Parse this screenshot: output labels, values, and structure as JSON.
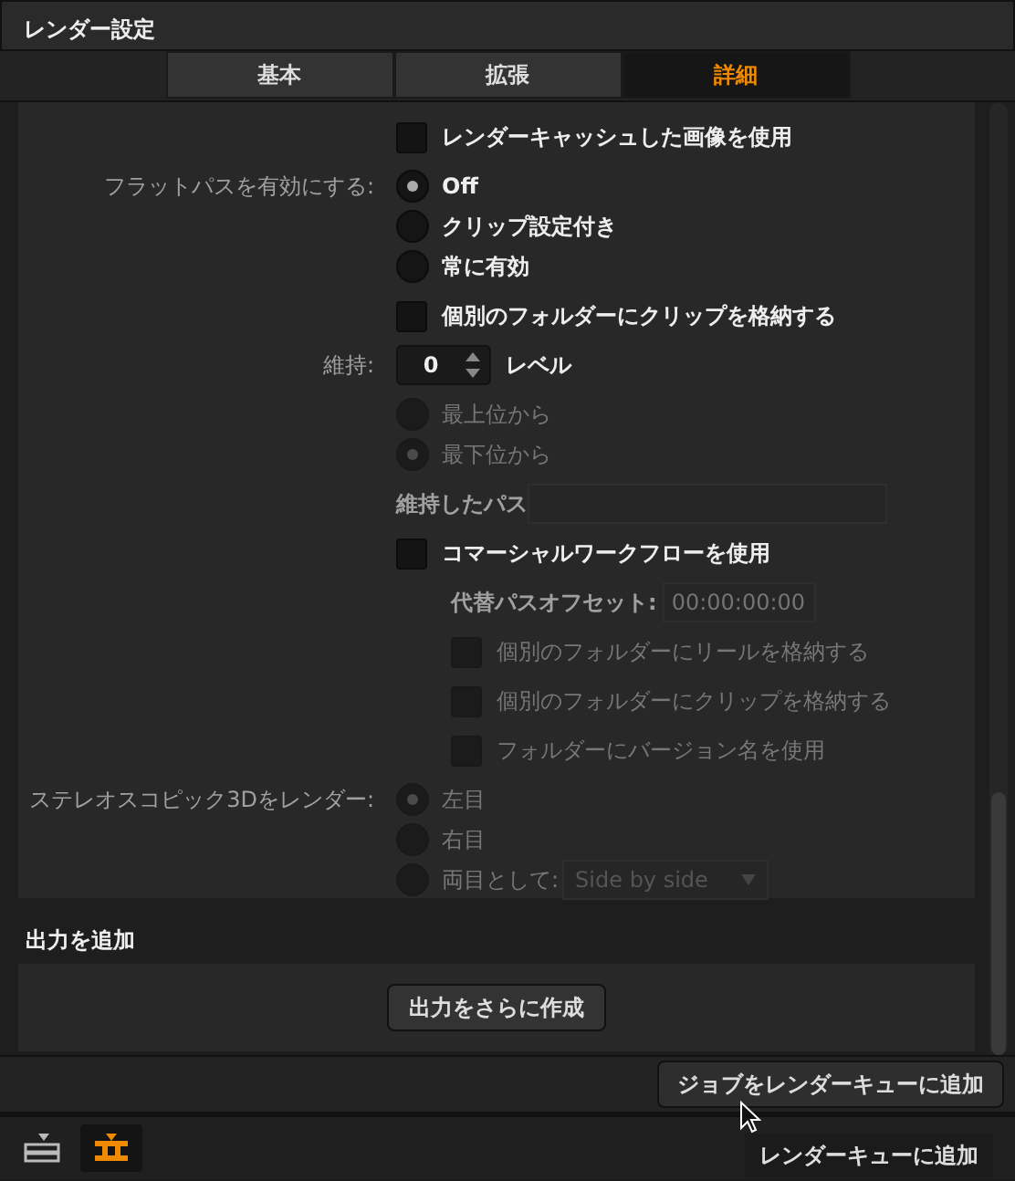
{
  "window": {
    "title": "レンダー設定"
  },
  "tabs": [
    {
      "label": "基本",
      "selected": false
    },
    {
      "label": "拡張",
      "selected": false
    },
    {
      "label": "詳細",
      "selected": true
    }
  ],
  "settings": [
    {
      "kind": "checkbox",
      "text": "レンダーキャッシュした画像を使用",
      "checked": false,
      "disabled": false
    },
    {
      "kind": "radio",
      "label": "フラットパスを有効にする:",
      "disabled": false,
      "options": [
        {
          "text": "Off",
          "selected": true
        },
        {
          "text": "クリップ設定付き",
          "selected": false
        },
        {
          "text": "常に有効",
          "selected": false
        }
      ]
    },
    {
      "kind": "checkbox",
      "text": "個別のフォルダーにクリップを格納する",
      "checked": false,
      "disabled": false
    },
    {
      "kind": "spinner",
      "label": "維持:",
      "value": "0",
      "unit": "レベル",
      "disabled": false
    },
    {
      "kind": "radio",
      "disabled": true,
      "options": [
        {
          "text": "最上位から",
          "selected": false
        },
        {
          "text": "最下位から",
          "selected": true
        }
      ]
    },
    {
      "kind": "field",
      "text": "維持したパス",
      "disabled": true
    },
    {
      "kind": "checkbox",
      "text": "コマーシャルワークフローを使用",
      "checked": false,
      "disabled": false,
      "children": [
        {
          "kind": "field",
          "text": "代替パスオフセット:",
          "placeholder": "00:00:00:00",
          "disabled": true
        },
        {
          "kind": "checkbox",
          "text": "個別のフォルダーにリールを格納する",
          "checked": false,
          "disabled": true
        },
        {
          "kind": "checkbox",
          "text": "個別のフォルダーにクリップを格納する",
          "checked": false,
          "disabled": true
        },
        {
          "kind": "checkbox",
          "text": "フォルダーにバージョン名を使用",
          "checked": false,
          "disabled": true
        }
      ]
    },
    {
      "kind": "radio",
      "label": "ステレオスコピック3Dをレンダー:",
      "disabled": true,
      "options": [
        {
          "text": "左目",
          "selected": true
        },
        {
          "text": "右目",
          "selected": false
        },
        {
          "text": "両目として:",
          "selected": false,
          "dropdown": "Side by side"
        }
      ]
    }
  ],
  "output_section": {
    "title": "出力を追加",
    "button": "出力をさらに作成"
  },
  "footer_button": "ジョブをレンダーキューに追加",
  "toolbar": [
    {
      "selected": false
    },
    {
      "selected": true
    }
  ],
  "tooltip": "レンダーキューに追加"
}
